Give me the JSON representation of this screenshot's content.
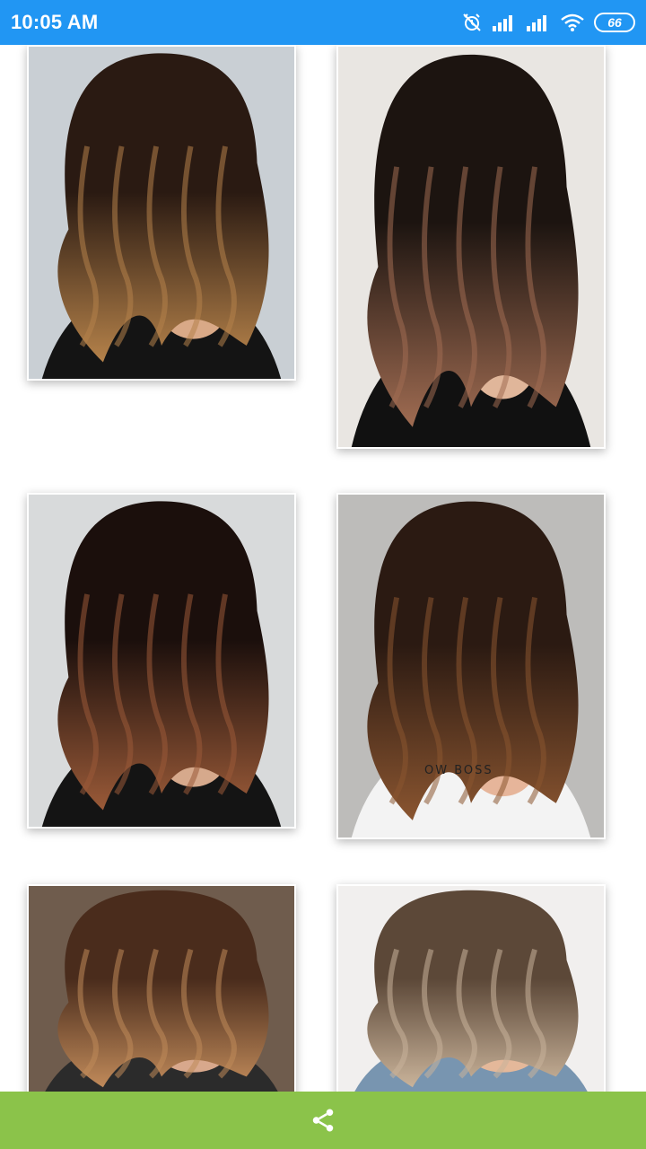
{
  "status_bar": {
    "time": "10:05 AM",
    "battery_level": "66",
    "icons": [
      "alarm-off-icon",
      "signal-icon",
      "signal-icon",
      "wifi-icon",
      "battery-icon"
    ]
  },
  "gallery": {
    "items": [
      {
        "name": "hair-photo-1",
        "colors": {
          "bg": "#c9cfd4",
          "hair_dark": "#2a1a12",
          "hair_light": "#b5824a",
          "top": "#141414",
          "skin": "#d9a987"
        }
      },
      {
        "name": "hair-photo-2",
        "colors": {
          "bg": "#e9e6e2",
          "hair_dark": "#1c1410",
          "hair_light": "#a06c52",
          "top": "#111111",
          "skin": "#e0b69a"
        }
      },
      {
        "name": "hair-photo-3",
        "colors": {
          "bg": "#d8dadb",
          "hair_dark": "#1b0f0c",
          "hair_light": "#9a5a38",
          "top": "#141414",
          "skin": "#d6a98c"
        }
      },
      {
        "name": "hair-photo-4",
        "colors": {
          "bg": "#bdbcba",
          "hair_dark": "#2b1a12",
          "hair_light": "#8a5530",
          "top": "#f3f3f3",
          "skin": "#e6b59a"
        }
      },
      {
        "name": "hair-photo-5",
        "colors": {
          "bg": "#6f5c4d",
          "hair_dark": "#4a2c1c",
          "hair_light": "#c08a5a",
          "top": "#2b2b2b",
          "skin": "#d8a88c"
        }
      },
      {
        "name": "hair-photo-6",
        "colors": {
          "bg": "#f1efee",
          "hair_dark": "#5c4838",
          "hair_light": "#c9b39a",
          "top": "#7895b0",
          "skin": "#e4b89a"
        }
      }
    ],
    "visible_text": "OW BOSS"
  },
  "bottom_bar": {
    "share_icon": "share-icon",
    "color": "#8bc34a"
  }
}
